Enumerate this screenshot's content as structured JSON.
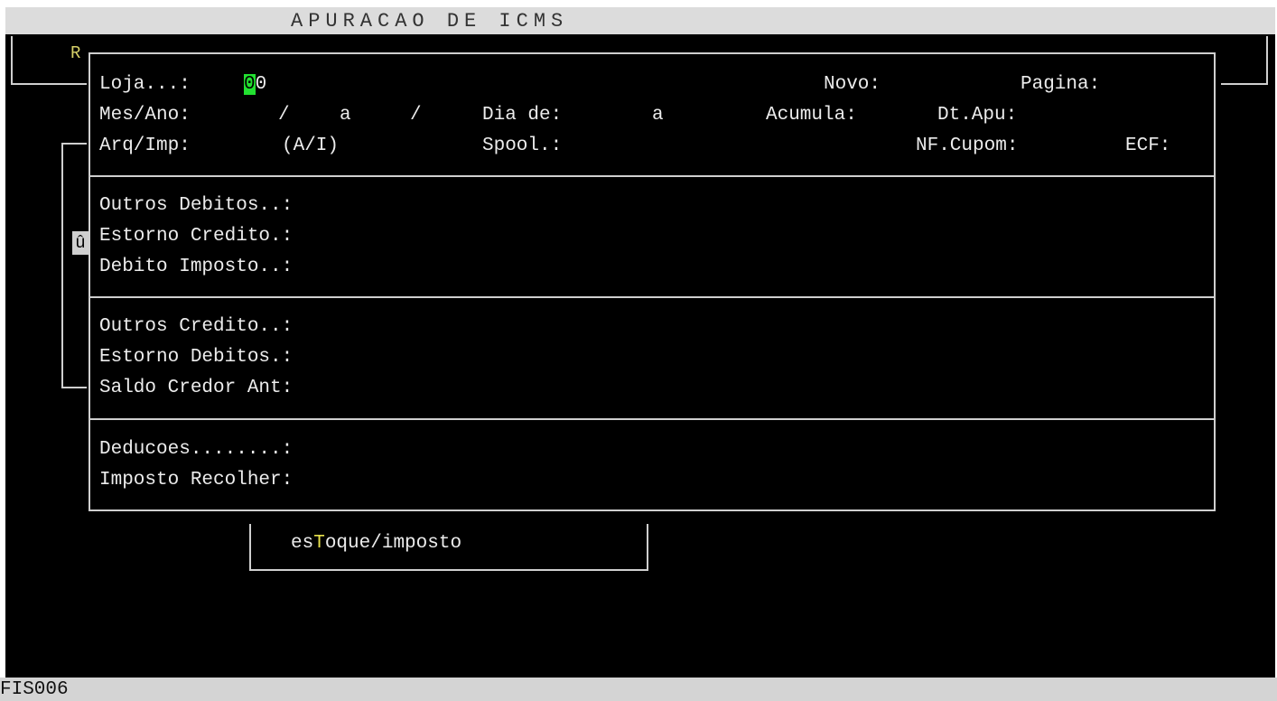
{
  "window": {
    "title": "APURACAO DE ICMS",
    "program_code": "FIS006"
  },
  "frame": {
    "corner_label": "R",
    "scroll_indicator": "û"
  },
  "header": {
    "loja_label": "Loja...:",
    "loja_cursor_char": "0",
    "loja_rest": "0",
    "novo_label": "Novo:",
    "pagina_label": "Pagina:",
    "mes_ano_label": "Mes/Ano:",
    "mes_ano_sep1": "/",
    "mes_ano_a": "a",
    "mes_ano_sep2": "/",
    "dia_de_label": "Dia de:",
    "dia_a": "a",
    "acumula_label": "Acumula:",
    "dt_apu_label": "Dt.Apu:",
    "arq_imp_label": "Arq/Imp:",
    "arq_imp_options": "(A/I)",
    "spool_label": "Spool.:",
    "nf_cupom_label": "NF.Cupom:",
    "ecf_label": "ECF:"
  },
  "debitos": {
    "outros_debitos": "Outros Debitos..:",
    "estorno_credito": "Estorno Credito.:",
    "debito_imposto": "Debito Imposto..:"
  },
  "creditos": {
    "outros_credito": "Outros Credito..:",
    "estorno_debitos": "Estorno Debitos.:",
    "saldo_credor_ant": "Saldo Credor Ant:"
  },
  "totais": {
    "deducoes": "Deducoes........:",
    "imposto_recolher": "Imposto Recolher:"
  },
  "menu": {
    "estoque_prefix": "es",
    "estoque_hotkey": "T",
    "estoque_suffix": "oque/imposto"
  }
}
